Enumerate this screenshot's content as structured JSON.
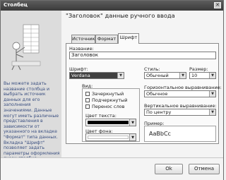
{
  "window": {
    "title": "Столбец",
    "close_glyph": "✕"
  },
  "header": {
    "title": "\"Заголовок\" данные ручного ввода"
  },
  "help_text": "Вы можете задать название столбца и выбрать источник данных для его заполнения значениями. Данные могут иметь различные представления в зависимости от указанного на вкладке \"Формат\" типа данных. Вкладка \"Шрифт\" позволяет задать параметры оформления ячеек столбца.",
  "tabs": [
    {
      "label": "Источник"
    },
    {
      "label": "Формат"
    },
    {
      "label": "Шрифт"
    }
  ],
  "form": {
    "name_label": "Название:",
    "name_value": "Заголовок",
    "font_label": "Шрифт:",
    "font_value": "Verdana",
    "style_label": "Стиль:",
    "style_value": "Обычный",
    "size_label": "Размер:",
    "size_value": "10",
    "view_label": "Вид:",
    "view_options": [
      "Зачеркнутый",
      "Подчеркнутый",
      "Перенос слов"
    ],
    "text_color_label": "Цвет текста:",
    "bg_color_label": "Цвет фона:",
    "halign_label": "Горизонтальное выравнивание:",
    "halign_value": "Обычное",
    "valign_label": "Вертикальное выравнивание:",
    "valign_value": "По центру",
    "preview_label": "Пример:",
    "preview_text": "AaBbCc"
  },
  "colors": {
    "text_color": "#000000",
    "bg_color": "#ffffff",
    "title_bar": "#4a4a4a",
    "help_text": "#3a4f80"
  },
  "buttons": {
    "ok": "Ok",
    "cancel": "Отмена"
  }
}
